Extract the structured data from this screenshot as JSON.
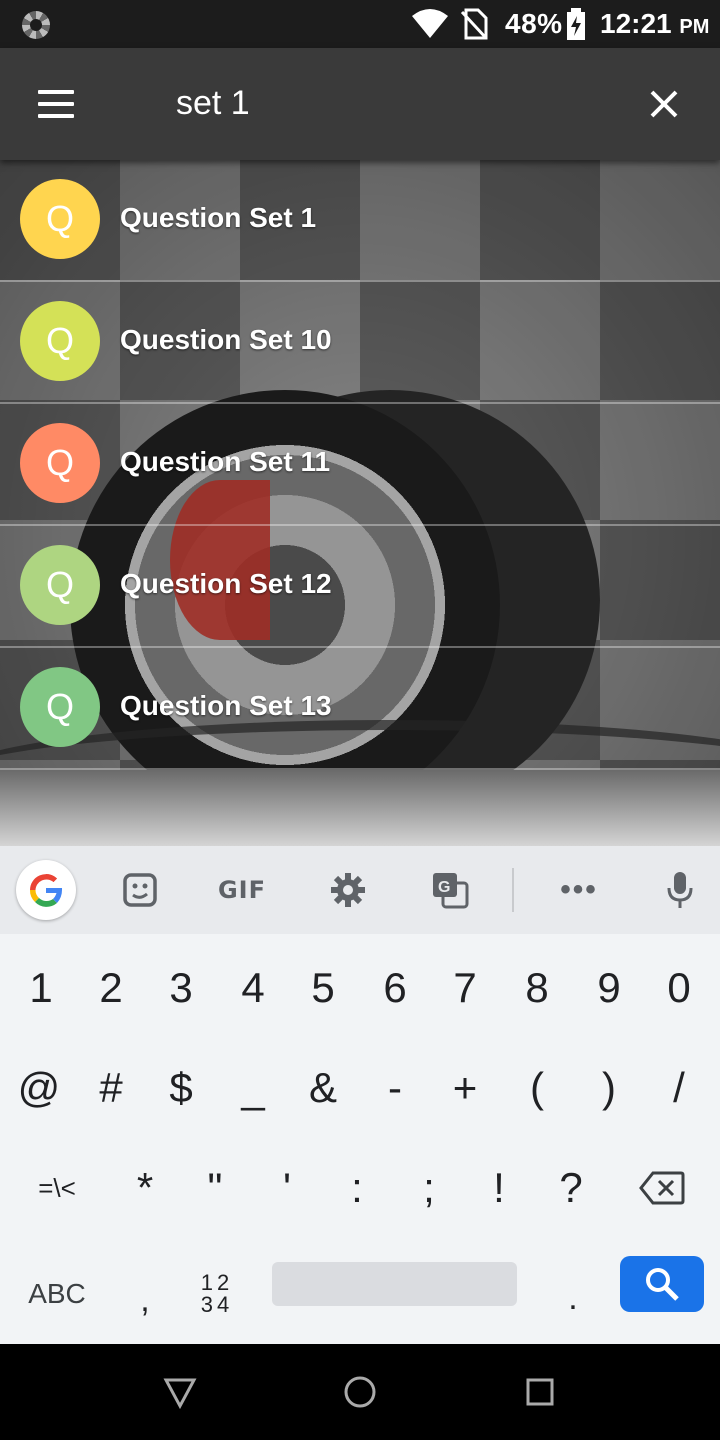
{
  "status_bar": {
    "battery_percent": "48%",
    "time": "12:21",
    "ampm": "PM"
  },
  "search_bar": {
    "query": "set 1",
    "menu_icon": "hamburger-icon",
    "close_icon": "close-icon"
  },
  "results": [
    {
      "initial": "Q",
      "title": "Question Set 1",
      "color": "#FFD54F"
    },
    {
      "initial": "Q",
      "title": "Question Set 10",
      "color": "#D4E157"
    },
    {
      "initial": "Q",
      "title": "Question Set 11",
      "color": "#FF8A65"
    },
    {
      "initial": "Q",
      "title": "Question Set 12",
      "color": "#AED581"
    },
    {
      "initial": "Q",
      "title": "Question Set 13",
      "color": "#81C784"
    }
  ],
  "keyboard": {
    "toolbar": {
      "gif_label": "GIF",
      "more_label": "•••"
    },
    "row1": [
      "1",
      "2",
      "3",
      "4",
      "5",
      "6",
      "7",
      "8",
      "9",
      "0"
    ],
    "row2": [
      "@",
      "#",
      "$",
      "_",
      "&",
      "-",
      "+",
      "(",
      ")",
      "/"
    ],
    "row3": [
      "=\\<",
      "*",
      "\"",
      "'",
      ":",
      ";",
      "!",
      "?"
    ],
    "row4": {
      "abc_label": "ABC",
      "comma": ",",
      "numpad_top": "12",
      "numpad_bottom": "34",
      "period": "."
    },
    "accent_color": "#1a73e8"
  }
}
